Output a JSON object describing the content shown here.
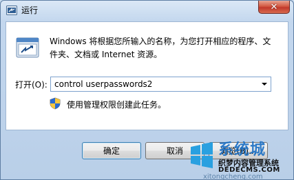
{
  "window": {
    "title": "运行",
    "close_glyph": "✕"
  },
  "dialog": {
    "description": "Windows 将根据您所输入的名称，为您打开相应的程序、文件夹、文档或 Internet 资源。",
    "open_label": "打开(O):",
    "command_value": "control userpasswords2",
    "admin_note": "使用管理权限创建此任务。"
  },
  "buttons": {
    "ok": "确定",
    "cancel": "取消",
    "browse": "浏览(B)..."
  },
  "watermark": {
    "brand": "系统城",
    "chinese": "织梦内容管理系统",
    "domain": "DEDECMS.COM",
    "bottom": "xitongcheng.com"
  },
  "icons": {
    "app": "run-icon",
    "dialog": "run-window-icon",
    "shield": "uac-shield-icon",
    "dropdown": "chevron-down-icon",
    "close": "close-icon"
  }
}
